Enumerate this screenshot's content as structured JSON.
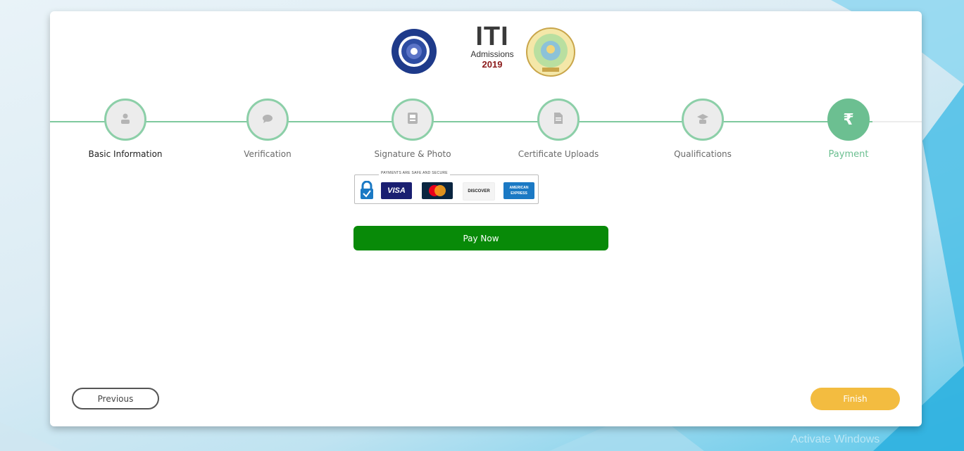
{
  "header": {
    "title_big": "ITI",
    "title_sub": "Admissions",
    "title_year": "2019"
  },
  "steps": [
    {
      "label": "Basic Information",
      "icon": "user-icon",
      "state": "done"
    },
    {
      "label": "Verification",
      "icon": "chat-icon",
      "state": "pending"
    },
    {
      "label": "Signature & Photo",
      "icon": "id-card-icon",
      "state": "pending"
    },
    {
      "label": "Certificate Uploads",
      "icon": "document-icon",
      "state": "pending"
    },
    {
      "label": "Qualifications",
      "icon": "graduate-icon",
      "state": "pending"
    },
    {
      "label": "Payment",
      "icon": "rupee-icon",
      "state": "current",
      "symbol": "₹"
    }
  ],
  "payment": {
    "secure_caption": "PAYMENTS ARE SAFE AND SECURE",
    "cards": [
      {
        "name": "visa-logo",
        "text": "VISA"
      },
      {
        "name": "mastercard-logo",
        "text": "MasterCard"
      },
      {
        "name": "discover-logo",
        "text": "DISCOVER"
      },
      {
        "name": "amex-logo",
        "text": "AMERICAN EXPRESS"
      }
    ],
    "pay_label": "Pay Now"
  },
  "nav": {
    "previous_label": "Previous",
    "finish_label": "Finish"
  },
  "watermark": "Activate Windows",
  "colors": {
    "accent_green": "#6cbf91",
    "pay_green": "#088a08",
    "finish_yellow": "#f3bc40"
  }
}
